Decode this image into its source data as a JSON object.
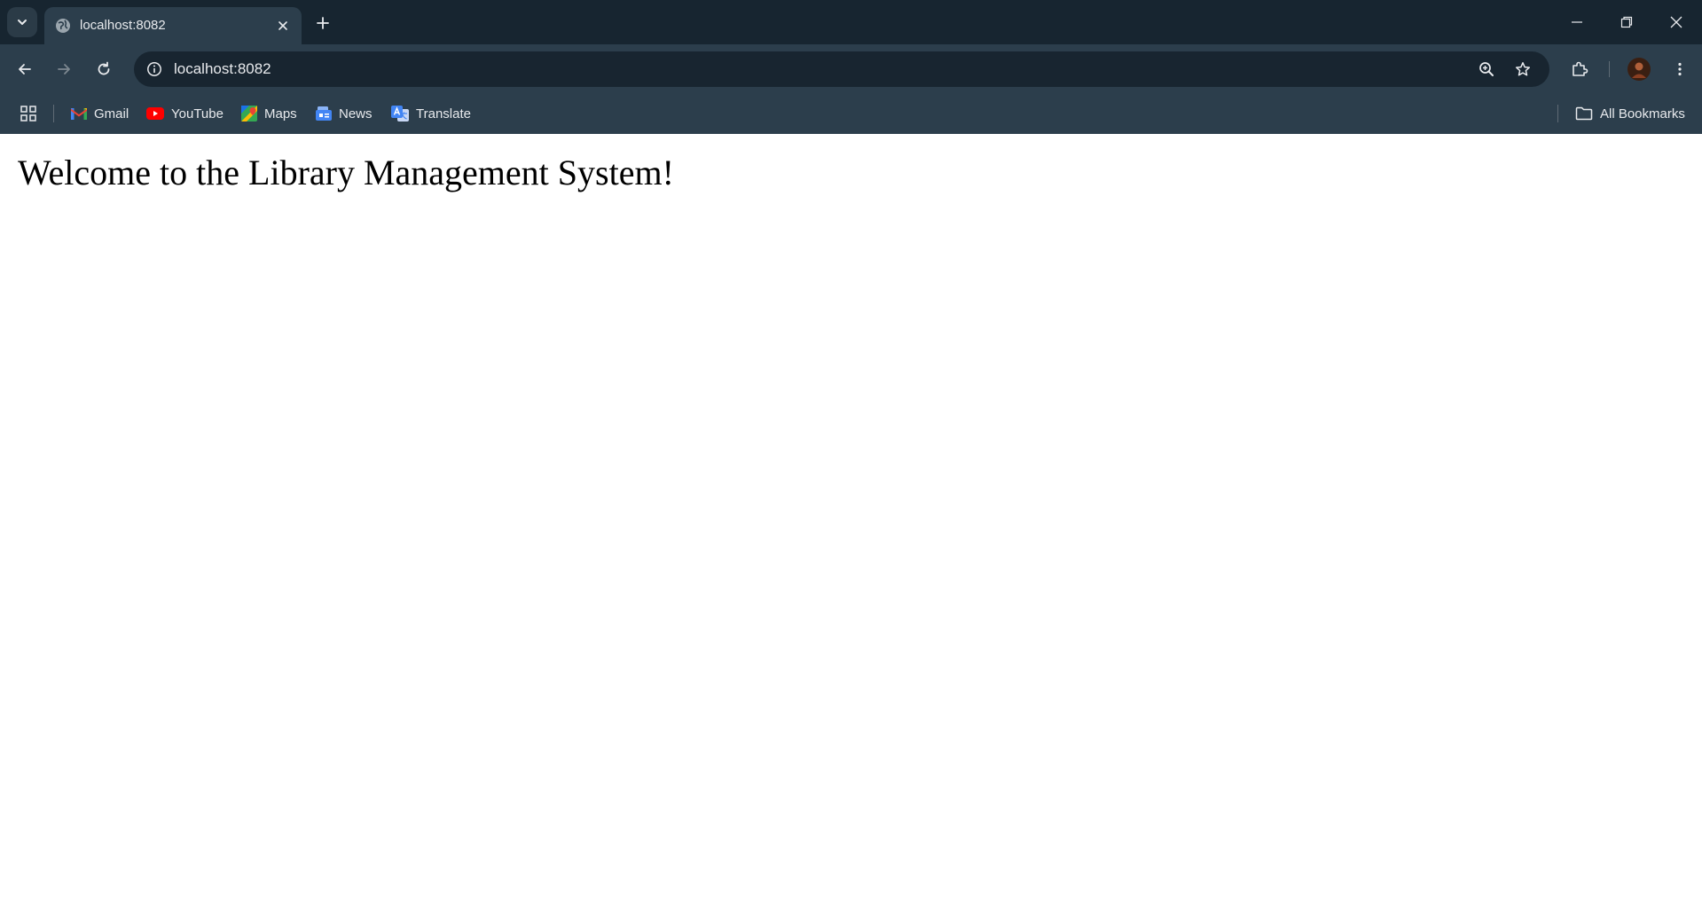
{
  "browser": {
    "tab": {
      "title": "localhost:8082"
    },
    "address_bar": {
      "url": "localhost:8082"
    },
    "bookmarks": [
      {
        "label": "Gmail",
        "icon": "gmail-icon"
      },
      {
        "label": "YouTube",
        "icon": "youtube-icon"
      },
      {
        "label": "Maps",
        "icon": "maps-icon"
      },
      {
        "label": "News",
        "icon": "news-icon"
      },
      {
        "label": "Translate",
        "icon": "translate-icon"
      }
    ],
    "all_bookmarks_label": "All Bookmarks",
    "colors": {
      "tabstrip": "#172530",
      "toolbar": "#2c3e4c",
      "omnibox": "#182530",
      "text": "#e8eaed"
    }
  },
  "page": {
    "heading": "Welcome to the Library Management System!"
  }
}
